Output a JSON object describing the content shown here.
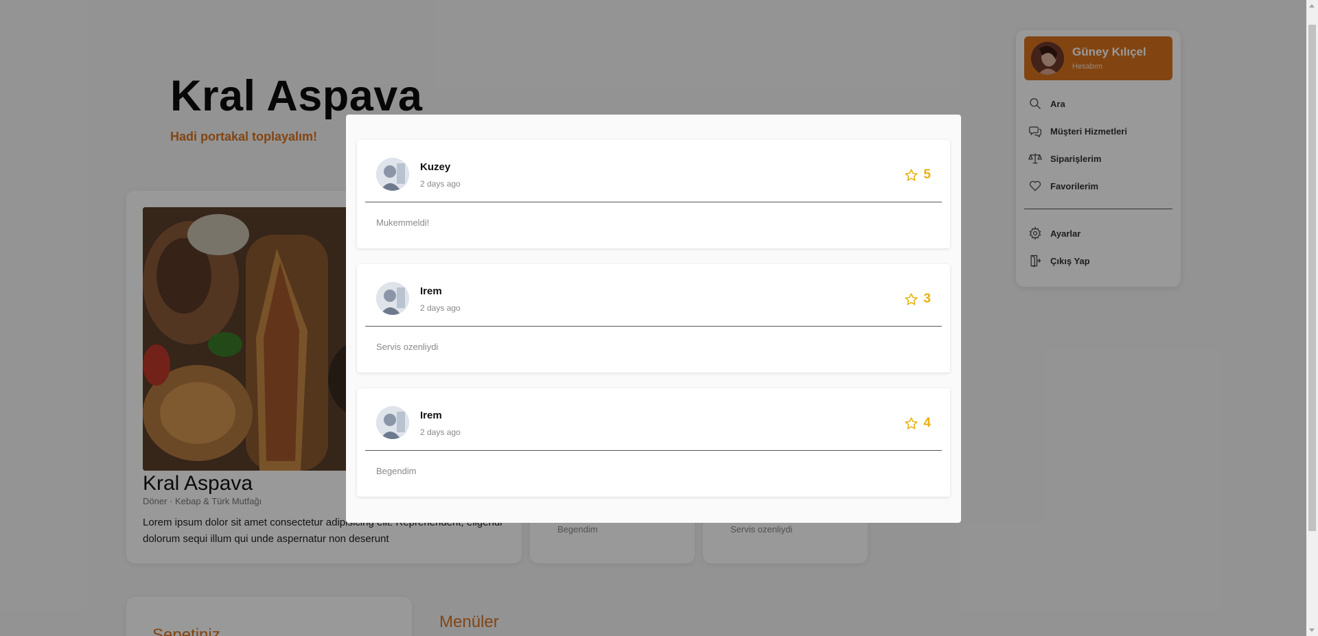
{
  "restaurant": {
    "name": "Kral Aspava",
    "tagline": "Hadi portakal toplayalım!",
    "card_title": "Kral Aspava",
    "category": "Döner · Kebap & Türk Mutfağı",
    "description": "Lorem ipsum dolor sit amet consectetur adipisicing elit. Reprehenderit, eligendi dolorum sequi illum qui unde aspernatur non deserunt"
  },
  "background_reviews": [
    "Begendim",
    "Servis ozenliydi"
  ],
  "cart": {
    "title": "Sepetiniz"
  },
  "menus": {
    "title": "Menüler"
  },
  "sidebar": {
    "profile": {
      "name": "Güney Kılıçel",
      "subtitle": "Hesabım"
    },
    "items": [
      {
        "label": "Ara",
        "icon": "search-icon"
      },
      {
        "label": "Müşteri Hizmetleri",
        "icon": "chat-icon"
      },
      {
        "label": "Siparişlerim",
        "icon": "scale-icon"
      },
      {
        "label": "Favorilerim",
        "icon": "heart-icon"
      },
      {
        "label": "Ayarlar",
        "icon": "gear-icon"
      },
      {
        "label": "Çıkış Yap",
        "icon": "door-exit-icon"
      }
    ]
  },
  "reviews": [
    {
      "name": "Kuzey",
      "date": "2 days ago",
      "rating": "5",
      "text": "Mukemmeldi!"
    },
    {
      "name": "Irem",
      "date": "2 days ago",
      "rating": "3",
      "text": "Servis ozenliydi"
    },
    {
      "name": "Irem",
      "date": "2 days ago",
      "rating": "4",
      "text": "Begendim"
    }
  ],
  "colors": {
    "accent": "#d9731e",
    "star": "#e8b10c"
  }
}
